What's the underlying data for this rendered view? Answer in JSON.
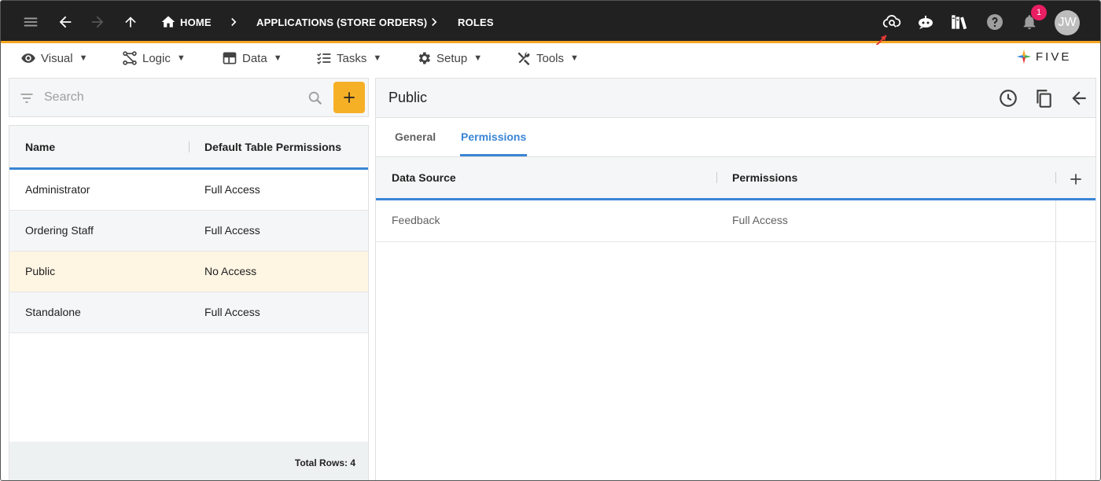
{
  "topbar": {
    "breadcrumbs": [
      "HOME",
      "APPLICATIONS (STORE ORDERS)",
      "ROLES"
    ],
    "notification_count": "1",
    "avatar_initials": "JW",
    "icons": [
      "menu-icon",
      "back-arrow-icon",
      "forward-arrow-icon",
      "up-arrow-icon",
      "home-icon",
      "cloud-search-icon",
      "chatbot-icon",
      "library-books-icon",
      "help-icon",
      "notifications-bell-icon"
    ],
    "accent_color": "#f5a623",
    "annotation_arrow_color": "#e53935"
  },
  "menubar": {
    "items": [
      {
        "label": "Visual",
        "icon": "eye-icon"
      },
      {
        "label": "Logic",
        "icon": "logic-flow-icon"
      },
      {
        "label": "Data",
        "icon": "table-grid-icon"
      },
      {
        "label": "Tasks",
        "icon": "checklist-icon"
      },
      {
        "label": "Setup",
        "icon": "gear-icon"
      },
      {
        "label": "Tools",
        "icon": "tools-icon"
      }
    ],
    "logo_text": "FIVE"
  },
  "left": {
    "search_placeholder": "Search",
    "columns": [
      "Name",
      "Default Table Permissions"
    ],
    "rows": [
      {
        "name": "Administrator",
        "permission": "Full Access"
      },
      {
        "name": "Ordering Staff",
        "permission": "Full Access"
      },
      {
        "name": "Public",
        "permission": "No Access"
      },
      {
        "name": "Standalone",
        "permission": "Full Access"
      }
    ],
    "selected_row": "Public",
    "total_rows": "Total Rows: 4",
    "add_button_color": "#f6b026"
  },
  "right": {
    "title": "Public",
    "tabs": [
      "General",
      "Permissions"
    ],
    "active_tab": "Permissions",
    "columns": [
      "Data Source",
      "Permissions"
    ],
    "rows": [
      {
        "data_source": "Feedback",
        "permissions": "Full Access"
      }
    ],
    "accent_color": "#3a85d6"
  }
}
